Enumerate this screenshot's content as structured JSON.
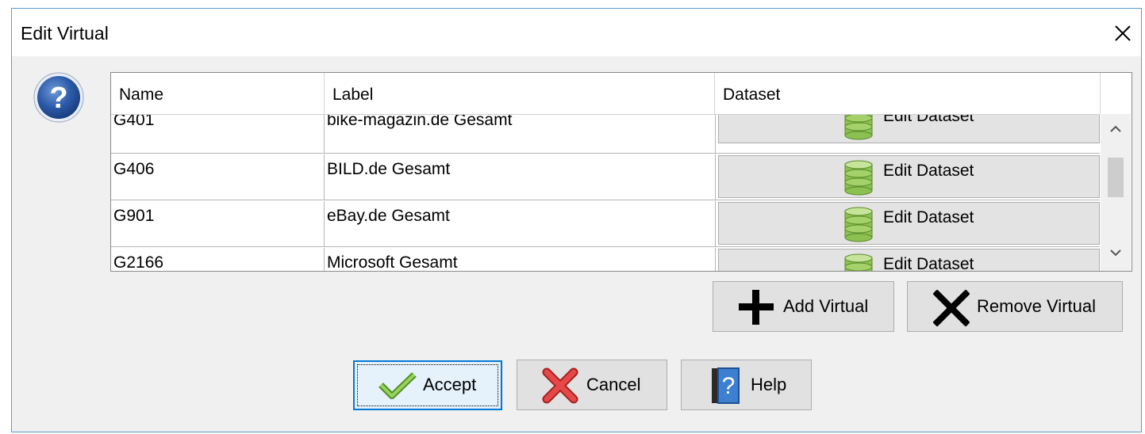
{
  "window": {
    "title": "Edit Virtual"
  },
  "icons": {
    "close": "close-icon",
    "help": "question-icon",
    "dataset": "database-icon",
    "add": "plus-icon",
    "remove": "x-icon",
    "accept": "checkmark-icon",
    "cancel": "red-x-icon",
    "help_book": "help-book-icon"
  },
  "table": {
    "columns": [
      "Name",
      "Label",
      "Dataset"
    ],
    "rows": [
      {
        "name": "G401",
        "label": "bike-magazin.de Gesamt",
        "dataset": "Edit Dataset"
      },
      {
        "name": "G406",
        "label": "BILD.de Gesamt",
        "dataset": "Edit Dataset"
      },
      {
        "name": "G901",
        "label": "eBay.de Gesamt",
        "dataset": "Edit Dataset"
      },
      {
        "name": "G2166",
        "label": "Microsoft Gesamt",
        "dataset": "Edit Dataset"
      }
    ]
  },
  "actions": {
    "add": "Add Virtual",
    "remove": "Remove Virtual"
  },
  "footer": {
    "accept": "Accept",
    "cancel": "Cancel",
    "help": "Help"
  },
  "colors": {
    "focus": "#0078d7",
    "accent_green": "#7ab648",
    "cancel_red": "#e03b3b"
  }
}
